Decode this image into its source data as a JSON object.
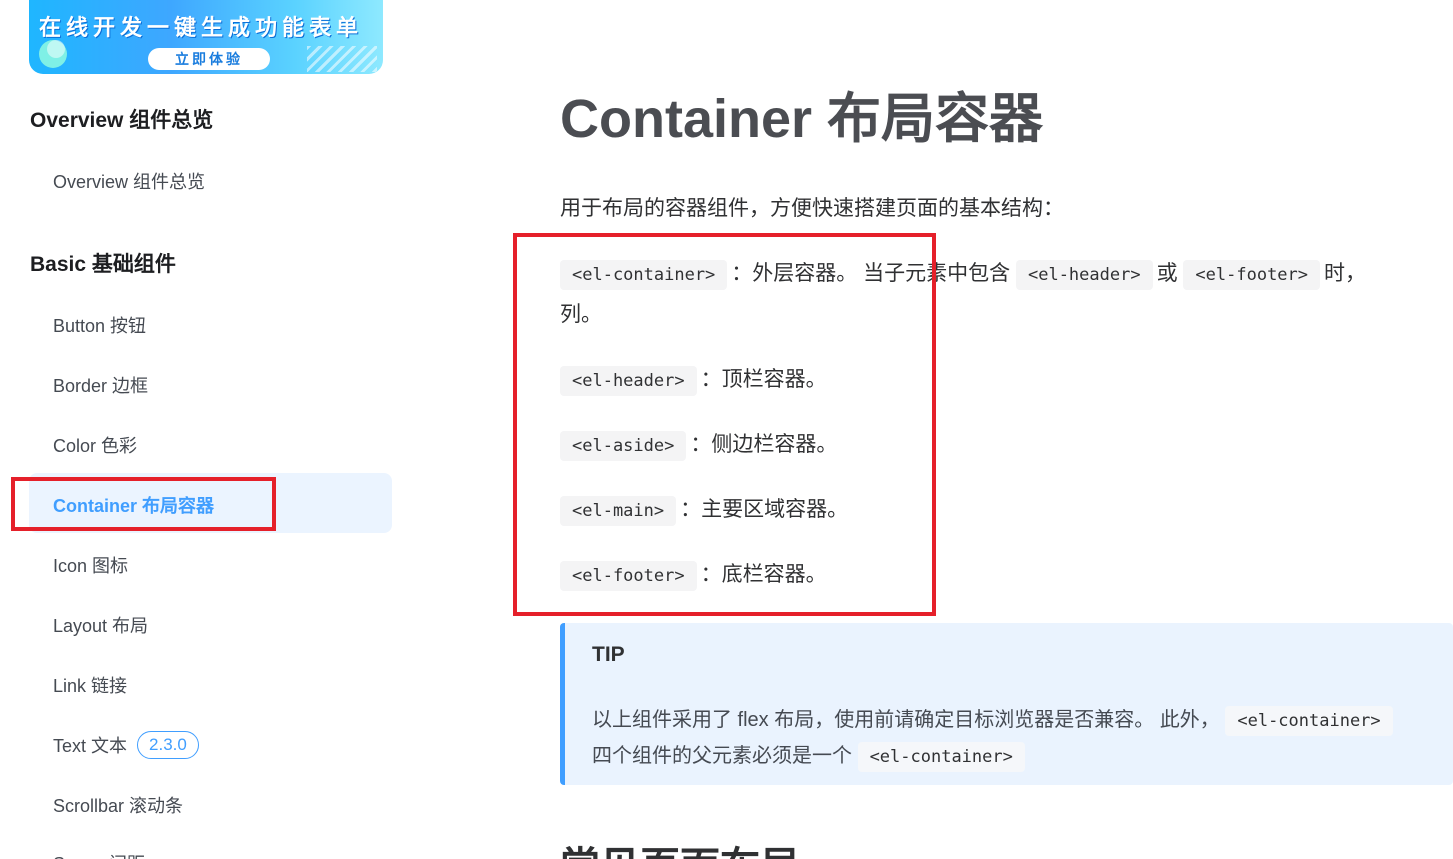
{
  "sidebar": {
    "banner": {
      "slogan": "在线开发一键生成功能表单",
      "button": "立即体验"
    },
    "groups": [
      {
        "title": "Overview 组件总览",
        "items": [
          "Overview 组件总览"
        ]
      },
      {
        "title": "Basic 基础组件",
        "items": [
          "Button 按钮",
          "Border 边框",
          "Color 色彩",
          "Container 布局容器",
          "Icon 图标",
          "Layout 布局",
          "Link 链接",
          "Text 文本",
          "Scrollbar 滚动条",
          "Space 间距"
        ]
      }
    ],
    "active_item": "Container 布局容器",
    "text_version_badge": "2.3.0"
  },
  "content": {
    "title": "Container 布局容器",
    "intro": "用于布局的容器组件，方便快速搭建页面的基本结构：",
    "items": [
      {
        "code": "<el-container>",
        "desc": "：外层容器。 当子元素中包含",
        "code2": "<el-header>",
        "mid": "或",
        "code3": "<el-footer>",
        "tail": "时，",
        "wrap": "列。"
      },
      {
        "code": "<el-header>",
        "desc": "：顶栏容器。"
      },
      {
        "code": "<el-aside>",
        "desc": "：侧边栏容器。"
      },
      {
        "code": "<el-main>",
        "desc": "：主要区域容器。"
      },
      {
        "code": "<el-footer>",
        "desc": "：底栏容器。"
      }
    ],
    "tip": {
      "title": "TIP",
      "line1_text": "以上组件采用了 flex 布局，使用前请确定目标浏览器是否兼容。 此外，",
      "line1_code": "<el-container>",
      "line2_text": "四个组件的父元素必须是一个",
      "line2_code": "<el-container>"
    },
    "next_heading": "常见页面布局"
  },
  "colors": {
    "accent": "#409eff",
    "annotation": "#e5202a",
    "tip_bg": "#eaf3fe"
  }
}
